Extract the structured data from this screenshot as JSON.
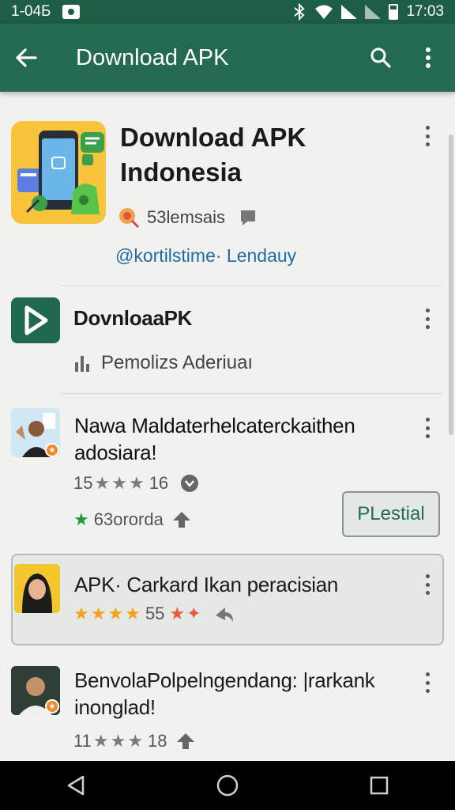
{
  "status_bar": {
    "left_text": "1-04Б",
    "time": "17:03"
  },
  "app_bar": {
    "title": "Download APK"
  },
  "hero": {
    "title_line1": "Download APK",
    "title_line2": "Indonesia",
    "meta": "53lemsais",
    "link": "@kortilstime· Lendauy"
  },
  "rows": [
    {
      "name": "DovnloaaPK",
      "sub": "Pemolizs Aderiuaı"
    },
    {
      "name_line1": "Nawa Maldaterhelcaterckaithen",
      "name_line2": "adosiara!",
      "rating_left": "15",
      "rating_right": "16",
      "downloads": "63ororda",
      "action_label": "PLestial"
    },
    {
      "name": "APK· Carkard Ikan peracisian",
      "rating": "55"
    },
    {
      "name_line1": "BenvolaPolpelngendang: |rarkank",
      "name_line2": "inonglad!",
      "rating_left": "11",
      "rating_right": "18"
    }
  ],
  "colors": {
    "status_bar": "#1d5e45",
    "app_bar": "#246a4e",
    "hero_icon_bg": "#f7c43b",
    "link": "#1f6da3",
    "star_gold": "#f4a21d",
    "star_green": "#1d9a3c"
  },
  "icons": {
    "back": "arrow-left-icon",
    "search": "search-icon",
    "overflow": "more-vert-icon",
    "play": "play-icon",
    "nav_back": "triangle-back-icon",
    "nav_home": "circle-home-icon",
    "nav_recent": "square-recent-icon"
  }
}
